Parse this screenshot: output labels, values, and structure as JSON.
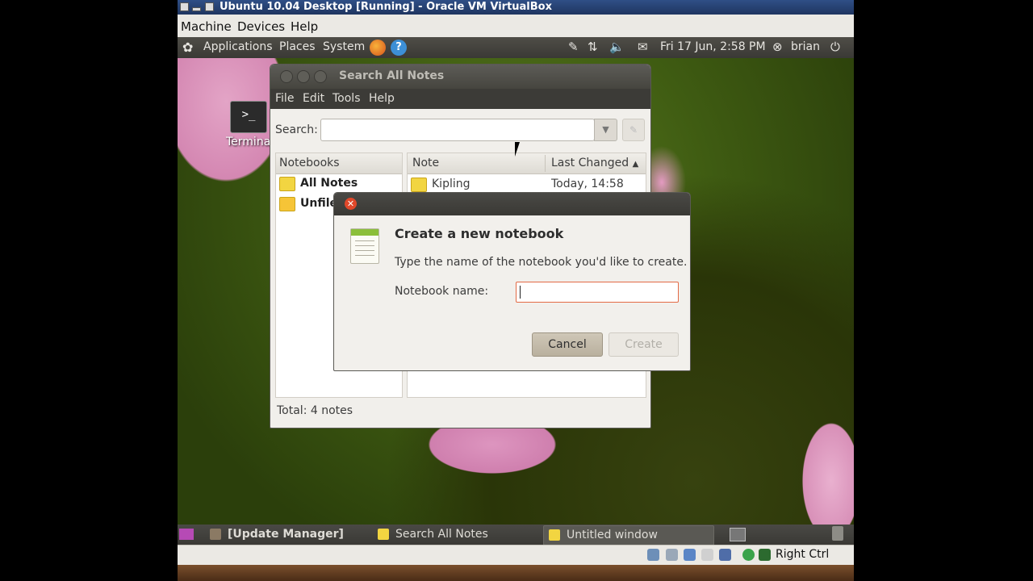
{
  "vbox": {
    "title": "Ubuntu 10.04 Desktop [Running] - Oracle VM VirtualBox",
    "menu": [
      "Machine",
      "Devices",
      "Help"
    ],
    "host_key": "Right Ctrl"
  },
  "top_panel": {
    "menus": [
      "Applications",
      "Places",
      "System"
    ],
    "datetime": "Fri 17 Jun,  2:58 PM",
    "user": "brian"
  },
  "desktop": {
    "icon_label": "Termina",
    "icon_glyph": ">_"
  },
  "tomboy": {
    "title": "Search All Notes",
    "menu": [
      "File",
      "Edit",
      "Tools",
      "Help"
    ],
    "search_label": "Search:",
    "search_value": "",
    "notebooks_header": "Notebooks",
    "notebooks": [
      "All Notes",
      "Unfile"
    ],
    "note_col": "Note",
    "last_changed_col": "Last Changed",
    "sort_glyph": "▲",
    "notes": [
      {
        "title": "Kipling",
        "changed": "Today, 14:58"
      }
    ],
    "total": "Total: 4 notes"
  },
  "dialog": {
    "heading": "Create a new notebook",
    "message": "Type the name of the notebook you'd like to create.",
    "name_label": "Notebook name:",
    "name_value": "",
    "cancel": "Cancel",
    "create": "Create"
  },
  "taskbar": {
    "tasks": [
      "[Update Manager]",
      "Search All Notes",
      "Untitled window"
    ]
  },
  "colors": {
    "panel": "#3c3b37",
    "accent_orange": "#e0482a",
    "note_yellow": "#f2d541"
  }
}
